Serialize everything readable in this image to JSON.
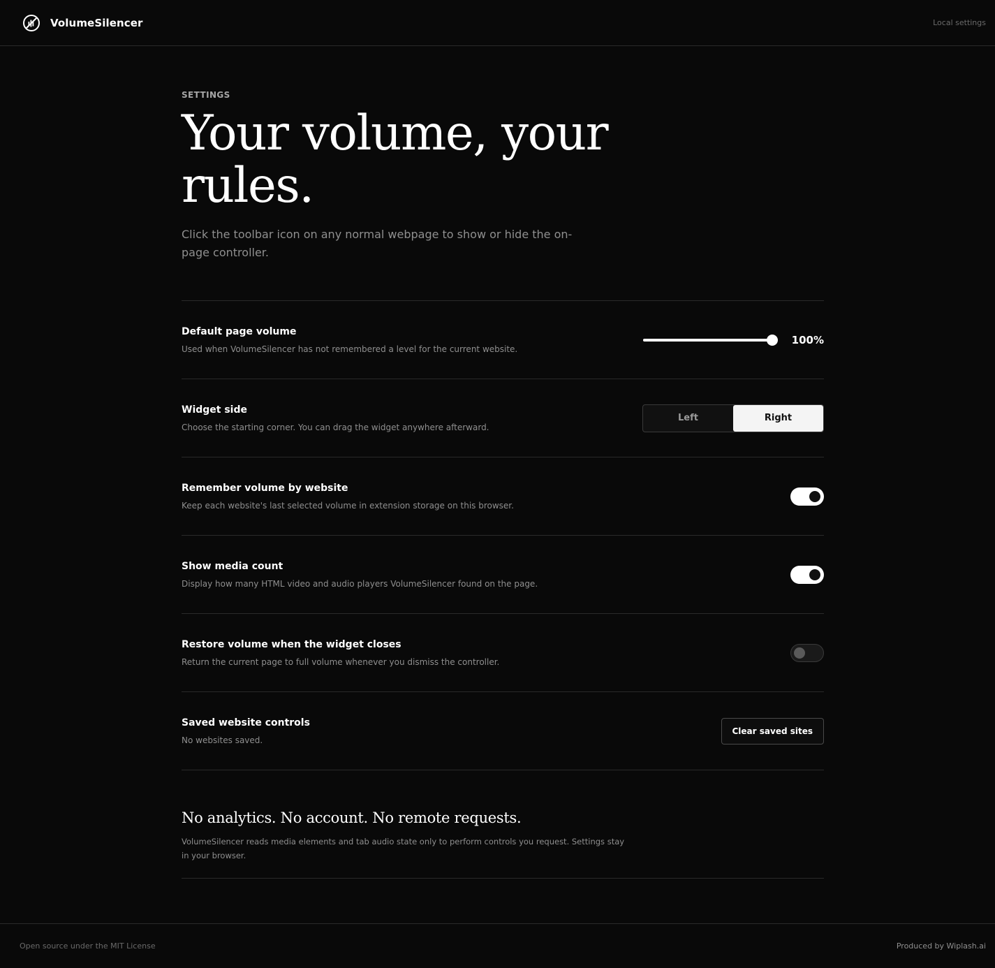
{
  "header": {
    "brand_name": "VolumeSilencer",
    "right_label": "Local settings"
  },
  "hero": {
    "eyebrow": "SETTINGS",
    "title": "Your volume, your rules.",
    "subtitle": "Click the toolbar icon on any normal webpage to show or hide the on-page controller."
  },
  "settings": {
    "default_volume": {
      "title": "Default page volume",
      "description": "Used when VolumeSilencer has not remembered a level for the current website.",
      "value_percent": 100,
      "value_label": "100%"
    },
    "widget_side": {
      "title": "Widget side",
      "description": "Choose the starting corner. You can drag the widget anywhere afterward.",
      "options": [
        "Left",
        "Right"
      ],
      "selected": "Right"
    },
    "remember_volume": {
      "title": "Remember volume by website",
      "description": "Keep each website's last selected volume in extension storage on this browser.",
      "enabled": true
    },
    "show_media_count": {
      "title": "Show media count",
      "description": "Display how many HTML video and audio players VolumeSilencer found on the page.",
      "enabled": true
    },
    "restore_volume": {
      "title": "Restore volume when the widget closes",
      "description": "Return the current page to full volume whenever you dismiss the controller.",
      "enabled": false
    },
    "saved_sites": {
      "title": "Saved website controls",
      "description": "No websites saved.",
      "button_label": "Clear saved sites"
    }
  },
  "privacy": {
    "title": "No analytics. No account. No remote requests.",
    "text": "VolumeSilencer reads media elements and tab audio state only to perform controls you request. Settings stay in your browser."
  },
  "footer": {
    "left": "Open source under the MIT License",
    "right": "Produced by Wiplash.ai"
  },
  "icons": {
    "brand": "muted-speaker-logo-icon"
  },
  "colors": {
    "background": "#090909",
    "accent": "#ffffff",
    "muted_text": "#8f8f8f",
    "divider": "#2a2a2a"
  }
}
